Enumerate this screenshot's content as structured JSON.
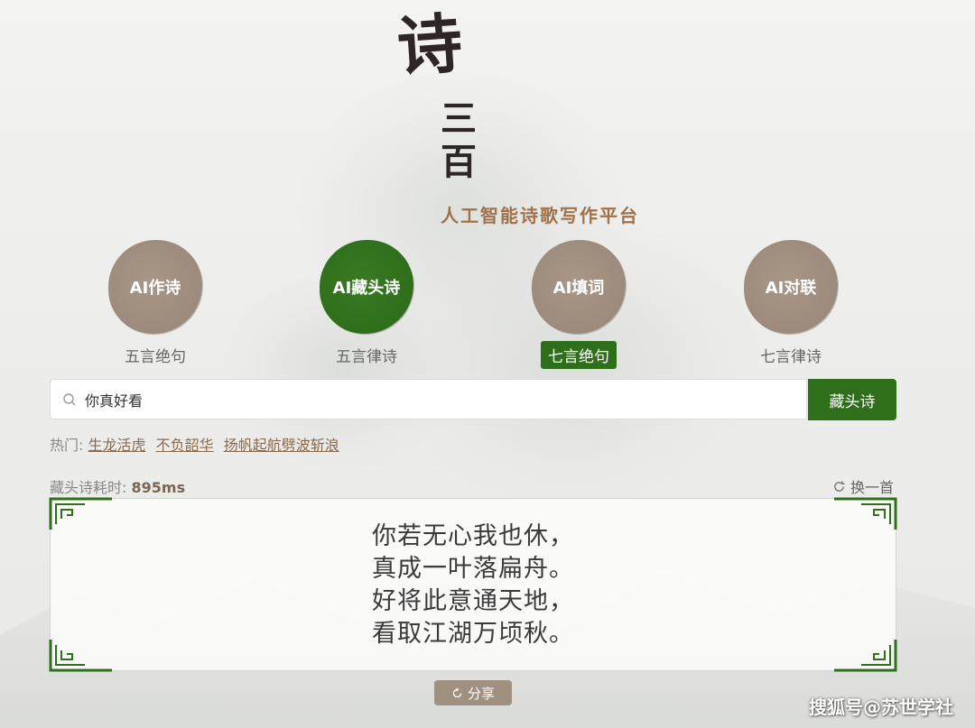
{
  "logo": {
    "main": "诗",
    "sub1": "三",
    "sub2": "百"
  },
  "slogan": "人工智能诗歌写作平台",
  "modes": [
    {
      "label": "AI作诗",
      "sub": "五言绝句"
    },
    {
      "label": "AI藏头诗",
      "sub": "五言律诗"
    },
    {
      "label": "AI填词",
      "sub": "七言绝句"
    },
    {
      "label": "AI对联",
      "sub": "七言律诗"
    }
  ],
  "active_mode": "AI藏头诗",
  "selected_format": "七言绝句",
  "search": {
    "value": "你真好看",
    "button_label": "藏头诗"
  },
  "hot": {
    "label": "热门:",
    "items": [
      "生龙活虎",
      "不负韶华",
      "扬帆起航劈波斩浪"
    ]
  },
  "timing": {
    "label": "藏头诗耗时:",
    "value": "895ms"
  },
  "refresh_label": "换一首",
  "poem": {
    "lines": [
      "你若无心我也休，",
      "真成一叶落扁舟。",
      "好将此意通天地，",
      "看取江湖万顷秋。"
    ]
  },
  "share_label": "分享",
  "watermark": "搜狐号@苏世学社",
  "colors": {
    "accent_green": "#2f6e1b",
    "circle_brown": "#9c8b7c",
    "link_brown": "#8a6a4a"
  }
}
